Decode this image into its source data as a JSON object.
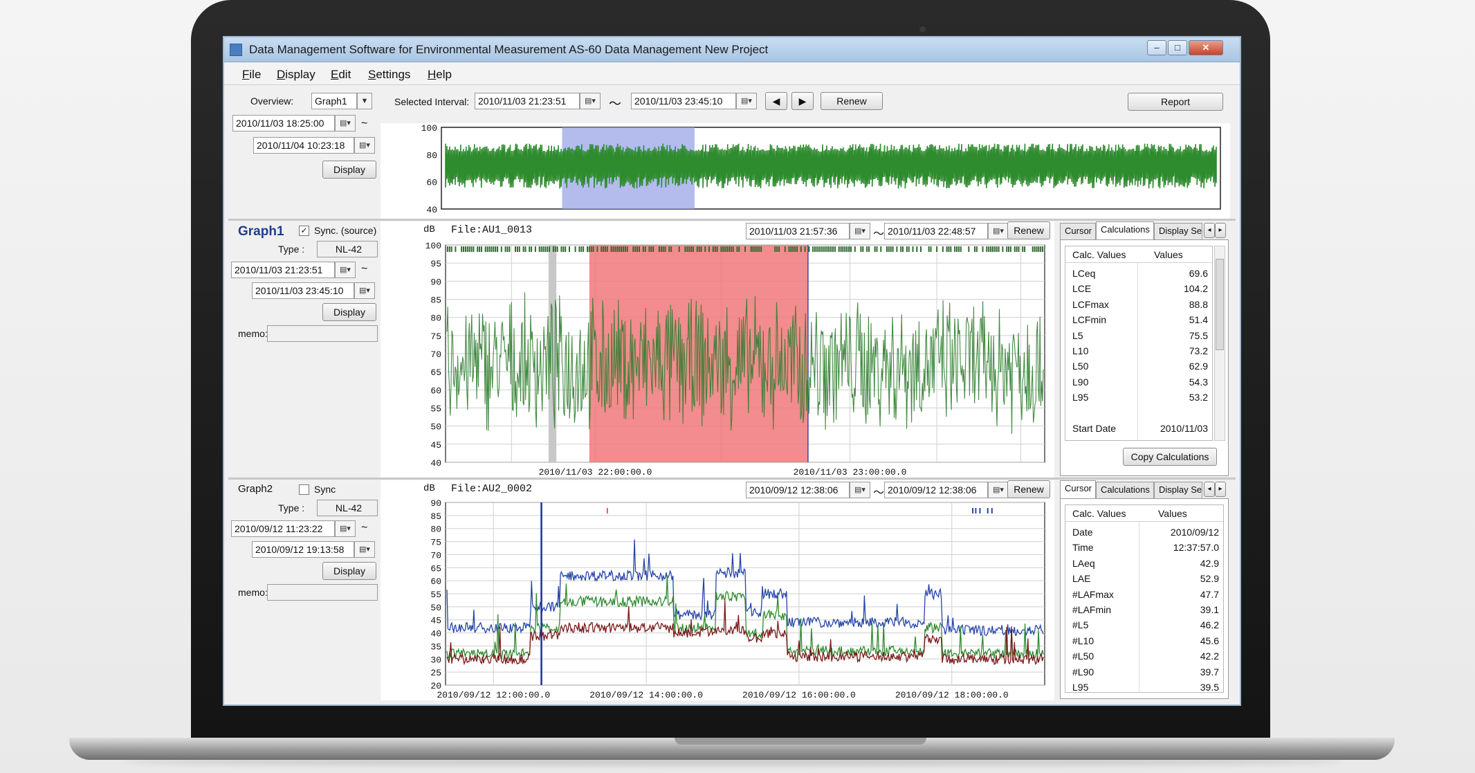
{
  "window": {
    "title": "Data Management Software for Environmental Measurement AS-60 Data Management New Project",
    "controls": {
      "minimize": "–",
      "maximize": "□",
      "close": "✕"
    }
  },
  "menu": [
    {
      "label": "File"
    },
    {
      "label": "Display"
    },
    {
      "label": "Edit"
    },
    {
      "label": "Settings"
    },
    {
      "label": "Help"
    }
  ],
  "overview": {
    "label": "Overview:",
    "select": "Graph1",
    "from": "2010/11/03 18:25:00",
    "to": "2010/11/04 10:23:18",
    "display_btn": "Display",
    "tilde": "~"
  },
  "interval": {
    "label": "Selected Interval:",
    "from": "2010/11/03 21:23:51",
    "to": "2010/11/03 23:45:10",
    "tilde": "〜",
    "prev": "◀",
    "next": "▶",
    "renew": "Renew"
  },
  "report_btn": "Report",
  "overview_chart": {
    "type": "area",
    "ylim": [
      40,
      100
    ],
    "yticks": [
      "100",
      "80",
      "60",
      "40"
    ],
    "color": "#2e8b2e",
    "selection_color": "#9aa6e6",
    "selection_range": [
      0.155,
      0.325
    ]
  },
  "graph1": {
    "title": "Graph1",
    "sync_label": "Sync. (source)",
    "sync_checked": "✓",
    "type_label": "Type :",
    "type_value": "NL-42",
    "from": "2010/11/03 21:23:51",
    "to": "2010/11/03 23:45:10",
    "display_btn": "Display",
    "memo_label": "memo:",
    "unit": "dB",
    "file": "File:AU1_0013",
    "range_from": "2010/11/03 21:57:36",
    "range_to": "2010/11/03 22:48:57",
    "renew": "Renew",
    "tabs": [
      "Cursor",
      "Calculations",
      "Display Se"
    ],
    "active_tab": 1,
    "table_header": [
      "Calc. Values",
      "Values"
    ],
    "rows": [
      {
        "name": "LCeq",
        "value": "69.6"
      },
      {
        "name": "LCE",
        "value": "104.2"
      },
      {
        "name": "LCFmax",
        "value": "88.8"
      },
      {
        "name": "LCFmin",
        "value": "51.4"
      },
      {
        "name": "L5",
        "value": "75.5"
      },
      {
        "name": "L10",
        "value": "73.2"
      },
      {
        "name": "L50",
        "value": "62.9"
      },
      {
        "name": "L90",
        "value": "54.3"
      },
      {
        "name": "L95",
        "value": "53.2"
      },
      {
        "name": "",
        "value": ""
      },
      {
        "name": "Start Date",
        "value": "2010/11/03"
      }
    ],
    "copy_btn": "Copy Calculations"
  },
  "graph1_chart": {
    "type": "line",
    "ylim": [
      40,
      100
    ],
    "yticks": [
      "100",
      "95",
      "90",
      "85",
      "80",
      "75",
      "70",
      "65",
      "60",
      "55",
      "50",
      "45",
      "40"
    ],
    "xticks": [
      {
        "pos": 0.25,
        "label": "2010/11/03 22:00:00.0"
      },
      {
        "pos": 0.675,
        "label": "2010/11/03 23:00:00.0"
      }
    ],
    "series": [
      {
        "color": "#2f7d2f"
      }
    ],
    "highlight_color": "#f0787a",
    "highlight_range": [
      0.24,
      0.605
    ],
    "marker_range": [
      0.172,
      0.185
    ]
  },
  "graph2": {
    "title": "Graph2",
    "sync_label": "Sync",
    "type_label": "Type :",
    "type_value": "NL-42",
    "from": "2010/09/12 11:23:22",
    "to": "2010/09/12 19:13:58",
    "display_btn": "Display",
    "memo_label": "memo:",
    "unit": "dB",
    "file": "File:AU2_0002",
    "range_from": "2010/09/12 12:38:06",
    "range_to": "2010/09/12 12:38:06",
    "renew": "Renew",
    "tabs": [
      "Cursor",
      "Calculations",
      "Display Se"
    ],
    "active_tab": 0,
    "table_header": [
      "Calc. Values",
      "Values"
    ],
    "rows": [
      {
        "name": "Date",
        "value": "2010/09/12"
      },
      {
        "name": "Time",
        "value": "12:37:57.0"
      },
      {
        "name": "LAeq",
        "value": "42.9"
      },
      {
        "name": "LAE",
        "value": "52.9"
      },
      {
        "name": "#LAFmax",
        "value": "47.7"
      },
      {
        "name": "#LAFmin",
        "value": "39.1"
      },
      {
        "name": "#L5",
        "value": "46.2"
      },
      {
        "name": "#L10",
        "value": "45.6"
      },
      {
        "name": "#L50",
        "value": "42.2"
      },
      {
        "name": "#L90",
        "value": "39.7"
      },
      {
        "name": "L95",
        "value": "39.5"
      }
    ]
  },
  "graph2_chart": {
    "type": "line",
    "ylim": [
      20,
      90
    ],
    "yticks": [
      "90",
      "85",
      "80",
      "75",
      "70",
      "65",
      "60",
      "55",
      "50",
      "45",
      "40",
      "35",
      "30",
      "25",
      "20"
    ],
    "xticks": [
      {
        "pos": 0.08,
        "label": "2010/09/12 12:00:00.0"
      },
      {
        "pos": 0.335,
        "label": "2010/09/12 14:00:00.0"
      },
      {
        "pos": 0.59,
        "label": "2010/09/12 16:00:00.0"
      },
      {
        "pos": 0.845,
        "label": "2010/09/12 18:00:00.0"
      }
    ],
    "cursor_pos": 0.16,
    "series": [
      {
        "color": "#2444a8",
        "levels": [
          [
            0,
            0.14,
            42
          ],
          [
            0.14,
            0.19,
            50
          ],
          [
            0.19,
            0.38,
            62
          ],
          [
            0.38,
            0.45,
            47
          ],
          [
            0.45,
            0.5,
            63
          ],
          [
            0.5,
            0.53,
            48
          ],
          [
            0.53,
            0.57,
            55
          ],
          [
            0.57,
            0.8,
            44
          ],
          [
            0.8,
            0.83,
            55
          ],
          [
            0.83,
            1,
            41
          ]
        ]
      },
      {
        "color": "#2f8a2f",
        "levels": [
          [
            0,
            0.14,
            32
          ],
          [
            0.14,
            0.19,
            42
          ],
          [
            0.19,
            0.38,
            52
          ],
          [
            0.38,
            0.45,
            42
          ],
          [
            0.45,
            0.5,
            54
          ],
          [
            0.5,
            0.53,
            40
          ],
          [
            0.53,
            0.57,
            47
          ],
          [
            0.57,
            0.8,
            33
          ],
          [
            0.8,
            0.83,
            42
          ],
          [
            0.83,
            1,
            32
          ]
        ]
      },
      {
        "color": "#7a1818",
        "levels": [
          [
            0,
            0.14,
            30
          ],
          [
            0.14,
            0.19,
            39
          ],
          [
            0.19,
            0.38,
            42
          ],
          [
            0.38,
            0.45,
            40
          ],
          [
            0.45,
            0.5,
            41
          ],
          [
            0.5,
            0.53,
            38
          ],
          [
            0.53,
            0.57,
            40
          ],
          [
            0.57,
            0.8,
            31
          ],
          [
            0.8,
            0.83,
            38
          ],
          [
            0.83,
            1,
            30
          ]
        ]
      }
    ]
  }
}
